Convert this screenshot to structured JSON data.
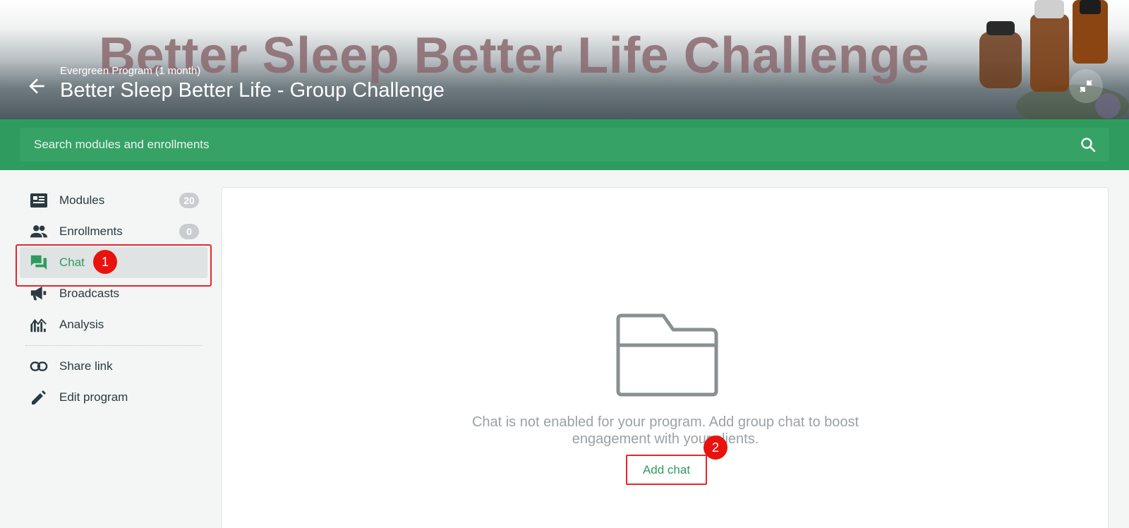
{
  "header": {
    "banner_text": "Better Sleep Better Life Challenge",
    "subtitle": "Evergreen Program (1 month)",
    "title": "Better Sleep Better Life - Group Challenge",
    "back_icon": "arrow-left-icon",
    "minimize_icon": "collapse-arrows-icon"
  },
  "search": {
    "placeholder": "Search modules and enrollments",
    "value": "",
    "icon": "search-icon"
  },
  "sidebar": {
    "items": [
      {
        "label": "Modules",
        "icon": "modules-icon",
        "badge": "20"
      },
      {
        "label": "Enrollments",
        "icon": "people-icon",
        "badge": "0"
      },
      {
        "label": "Chat",
        "icon": "chat-icon",
        "active": true
      },
      {
        "label": "Broadcasts",
        "icon": "megaphone-icon"
      },
      {
        "label": "Analysis",
        "icon": "analysis-icon"
      },
      {
        "label": "Share link",
        "icon": "link-icon"
      },
      {
        "label": "Edit program",
        "icon": "pencil-icon"
      }
    ]
  },
  "main": {
    "empty_icon": "folder-icon",
    "empty_message": "Chat is not enabled for your program. Add group chat to boost engagement with your clients.",
    "add_chat_label": "Add chat"
  },
  "annotations": {
    "marker_1": "1",
    "marker_2": "2",
    "highlight_color": "#e8262c"
  },
  "colors": {
    "accent": "#2e9c5e",
    "text": "#2b3a40",
    "muted": "#9aa1a5"
  }
}
